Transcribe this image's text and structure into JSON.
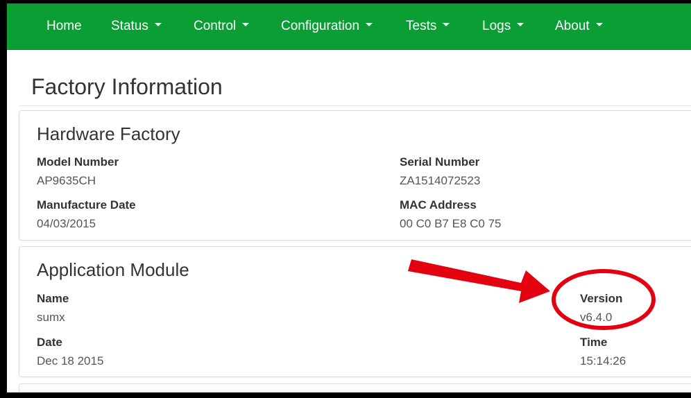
{
  "nav": {
    "home": "Home",
    "status": "Status",
    "control": "Control",
    "configuration": "Configuration",
    "tests": "Tests",
    "logs": "Logs",
    "about": "About"
  },
  "page": {
    "title": "Factory Information"
  },
  "hardware_factory": {
    "title": "Hardware Factory",
    "model_number_label": "Model Number",
    "model_number": "AP9635CH",
    "serial_number_label": "Serial Number",
    "serial_number": "ZA1514072523",
    "manufacture_date_label": "Manufacture Date",
    "manufacture_date": "04/03/2015",
    "mac_address_label": "MAC Address",
    "mac_address": "00 C0 B7 E8 C0 75"
  },
  "application_module": {
    "title": "Application Module",
    "name_label": "Name",
    "name": "sumx",
    "version_label": "Version",
    "version": "v6.4.0",
    "date_label": "Date",
    "date": "Dec 18 2015",
    "time_label": "Time",
    "time": "15:14:26"
  },
  "colors": {
    "navbar": "#0a9e35",
    "annotation": "#e3000f"
  },
  "icons": {
    "dropdown": "caret-down-icon",
    "annotation_arrow": "arrow-icon",
    "annotation_circle": "highlight-circle"
  }
}
